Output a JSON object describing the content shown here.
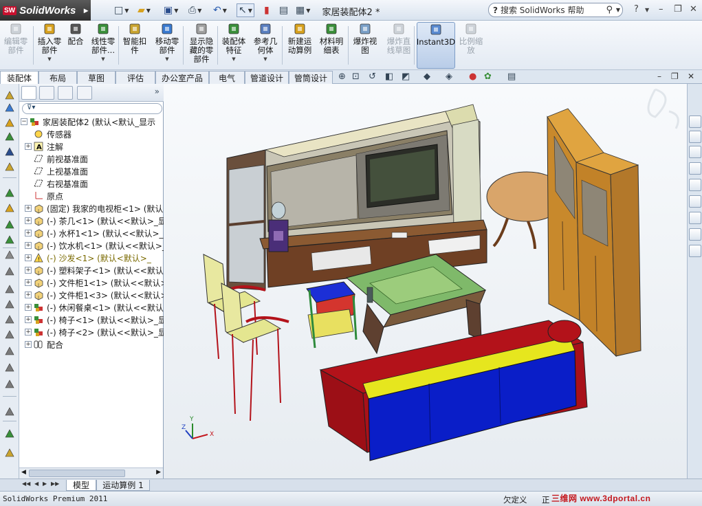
{
  "app": {
    "logo_text": "SolidWorks",
    "logo_badge": "SW",
    "document_title": "家居装配体2 *",
    "help_search_placeholder": "搜索 SolidWorks 帮助"
  },
  "command_manager": [
    {
      "label": "编辑零\n部件",
      "icon": "edit-component-icon",
      "disabled": true
    },
    {
      "label": "插入零\n部件",
      "icon": "insert-component-icon",
      "dropdown": true
    },
    {
      "label": "配合",
      "icon": "mate-icon"
    },
    {
      "label": "线性零\n部件...",
      "icon": "linear-pattern-icon",
      "dropdown": true
    },
    {
      "label": "智能扣\n件",
      "icon": "smart-fasteners-icon"
    },
    {
      "label": "移动零\n部件",
      "icon": "move-component-icon",
      "dropdown": true
    },
    {
      "label": "显示隐\n藏的零\n部件",
      "icon": "show-hidden-icon"
    },
    {
      "label": "装配体\n特征",
      "icon": "assembly-feature-icon",
      "dropdown": true
    },
    {
      "label": "参考几\n何体",
      "icon": "reference-geometry-icon",
      "dropdown": true
    },
    {
      "label": "新建运\n动算例",
      "icon": "new-motion-study-icon"
    },
    {
      "label": "材料明\n细表",
      "icon": "bom-icon"
    },
    {
      "label": "爆炸视\n图",
      "icon": "exploded-view-icon"
    },
    {
      "label": "爆炸直\n线草图",
      "icon": "explode-line-sketch-icon",
      "disabled": true
    },
    {
      "label": "Instant3D",
      "icon": "instant3d-icon",
      "active": true
    },
    {
      "label": "比例缩\n放",
      "icon": "scale-icon",
      "disabled": true
    }
  ],
  "tabs": [
    "装配体",
    "布局",
    "草图",
    "评估",
    "办公室产品",
    "电气",
    "管道设计",
    "管筒设计"
  ],
  "active_tab": "装配体",
  "feature_tree": {
    "filter_label": "",
    "root": "家居装配体2  (默认<默认_显示",
    "items": [
      {
        "text": "传感器",
        "icon": "sensor-icon",
        "expandable": false
      },
      {
        "text": "注解",
        "icon": "annotation-icon",
        "expandable": true
      },
      {
        "text": "前视基准面",
        "icon": "plane-icon",
        "expandable": false
      },
      {
        "text": "上视基准面",
        "icon": "plane-icon",
        "expandable": false
      },
      {
        "text": "右视基准面",
        "icon": "plane-icon",
        "expandable": false
      },
      {
        "text": "原点",
        "icon": "origin-icon",
        "expandable": false
      },
      {
        "text": "(固定) 我家的电视柜<1> (默认",
        "icon": "part-icon",
        "expandable": true
      },
      {
        "text": "(-) 茶几<1> (默认<<默认>_显示",
        "icon": "part-icon",
        "expandable": true
      },
      {
        "text": "(-) 水杯1<1> (默认<<默认>_显",
        "icon": "part-icon",
        "expandable": true
      },
      {
        "text": "(-) 饮水机<1> (默认<<默认>_显",
        "icon": "part-icon",
        "expandable": true
      },
      {
        "text": "(-) 沙发<1> (默认<默认>_",
        "icon": "warning-part-icon",
        "expandable": true,
        "warning": true
      },
      {
        "text": "(-) 塑料架子<1> (默认<<默认>",
        "icon": "part-icon",
        "expandable": true
      },
      {
        "text": "(-) 文件柜1<1> (默认<<默认>_",
        "icon": "part-icon",
        "expandable": true
      },
      {
        "text": "(-) 文件柜1<3> (默认<<默认>_",
        "icon": "part-icon",
        "expandable": true
      },
      {
        "text": "(-) 休闲餐桌<1> (默认<<默认>",
        "icon": "subassembly-icon",
        "expandable": true
      },
      {
        "text": "(-) 椅子<1> (默认<<默认>_显示",
        "icon": "subassembly-icon",
        "expandable": true
      },
      {
        "text": "(-) 椅子<2> (默认<<默认>_显示",
        "icon": "subassembly-icon",
        "expandable": true
      },
      {
        "text": "配合",
        "icon": "mates-folder-icon",
        "expandable": true
      }
    ]
  },
  "model_tabs": [
    "模型",
    "运动算例 1"
  ],
  "status": {
    "product": "SolidWorks Premium 2011",
    "definition": "欠定义",
    "editing": "正",
    "watermark": "三维网 www.3dportal.cn"
  },
  "triad": {
    "x": "X",
    "y": "Y",
    "z": "Z"
  },
  "colors": {
    "accent": "#7d9cc6",
    "sofa_body": "#b3121a",
    "sofa_cushion_front": "#0a1ec8",
    "sofa_cushion_top": "#e6e61e",
    "cabinet_wood": "#c8892c",
    "tv_frame": "#8a7f66"
  }
}
